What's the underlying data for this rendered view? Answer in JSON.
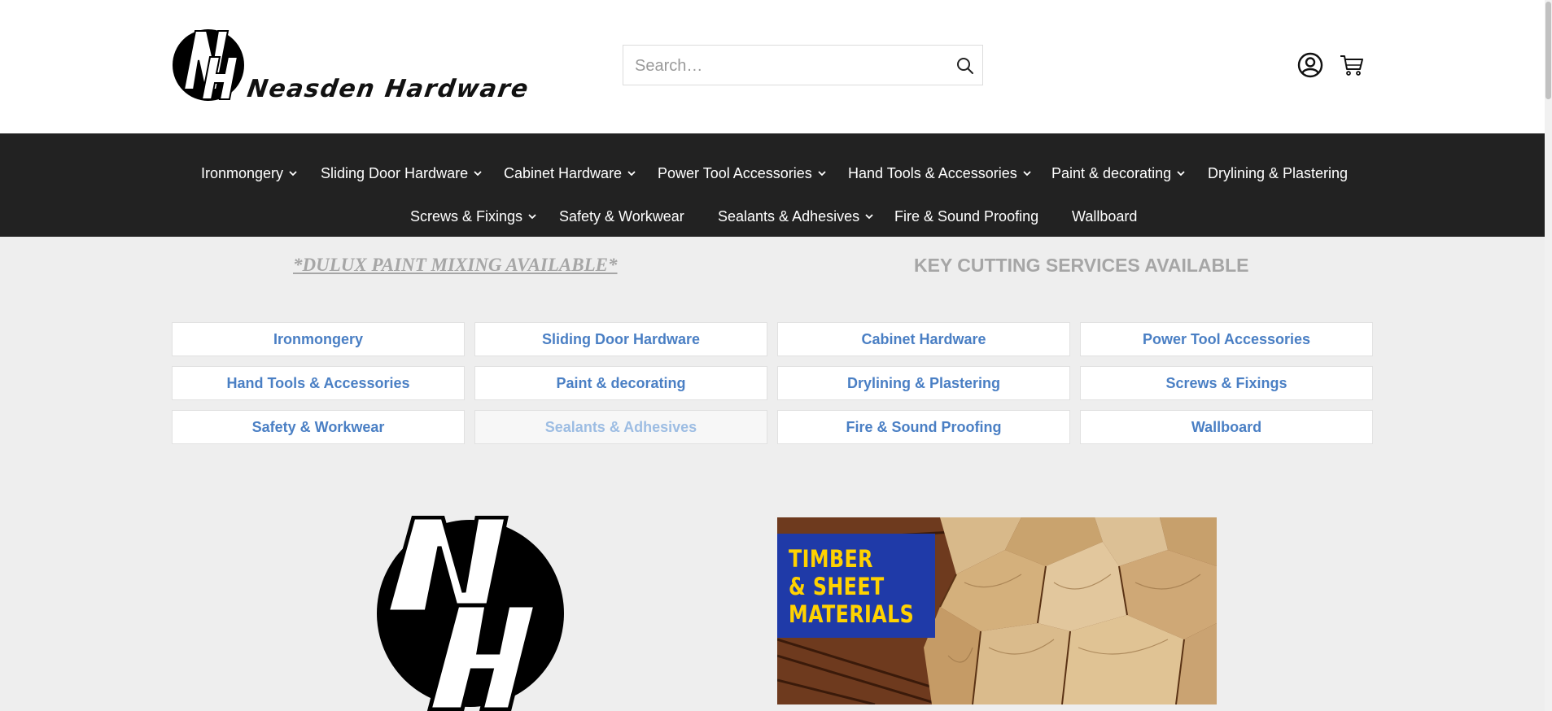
{
  "brand": {
    "name": "Neasden Hardware",
    "logo_letters": "NH"
  },
  "search": {
    "placeholder": "Search…"
  },
  "nav": {
    "row1": [
      {
        "label": "Ironmongery",
        "has_dropdown": true
      },
      {
        "label": "Sliding Door Hardware",
        "has_dropdown": true
      },
      {
        "label": "Cabinet Hardware",
        "has_dropdown": true
      },
      {
        "label": "Power Tool Accessories",
        "has_dropdown": true
      },
      {
        "label": "Hand Tools & Accessories",
        "has_dropdown": true
      },
      {
        "label": "Paint & decorating",
        "has_dropdown": true
      },
      {
        "label": "Drylining & Plastering",
        "has_dropdown": false
      }
    ],
    "row2": [
      {
        "label": "Screws & Fixings",
        "has_dropdown": true
      },
      {
        "label": "Safety & Workwear",
        "has_dropdown": false
      },
      {
        "label": "Sealants & Adhesives",
        "has_dropdown": true
      },
      {
        "label": "Fire & Sound Proofing",
        "has_dropdown": false
      },
      {
        "label": "Wallboard",
        "has_dropdown": false
      }
    ]
  },
  "promos": {
    "paint": "*DULUX PAINT MIXING AVAILABLE*",
    "keys": "KEY CUTTING SERVICES AVAILABLE"
  },
  "category_grid": [
    [
      "Ironmongery",
      "Sliding Door Hardware",
      "Cabinet Hardware",
      "Power Tool Accessories"
    ],
    [
      "Hand Tools & Accessories",
      "Paint & decorating",
      "Drylining & Plastering",
      "Screws & Fixings"
    ],
    [
      "Safety & Workwear",
      "Sealants & Adhesives",
      "Fire & Sound Proofing",
      "Wallboard"
    ]
  ],
  "banner": {
    "lines": [
      "TIMBER",
      "& SHEET",
      "MATERIALS"
    ]
  },
  "icons": {
    "search": "search-icon",
    "account": "account-icon",
    "cart": "cart-icon",
    "dropdown": "chevron-down-icon"
  },
  "colors": {
    "nav_bg": "#222222",
    "link_blue": "#4a7fc4",
    "promo_grey": "#a6a6a6",
    "page_bg": "#eeeeee"
  }
}
